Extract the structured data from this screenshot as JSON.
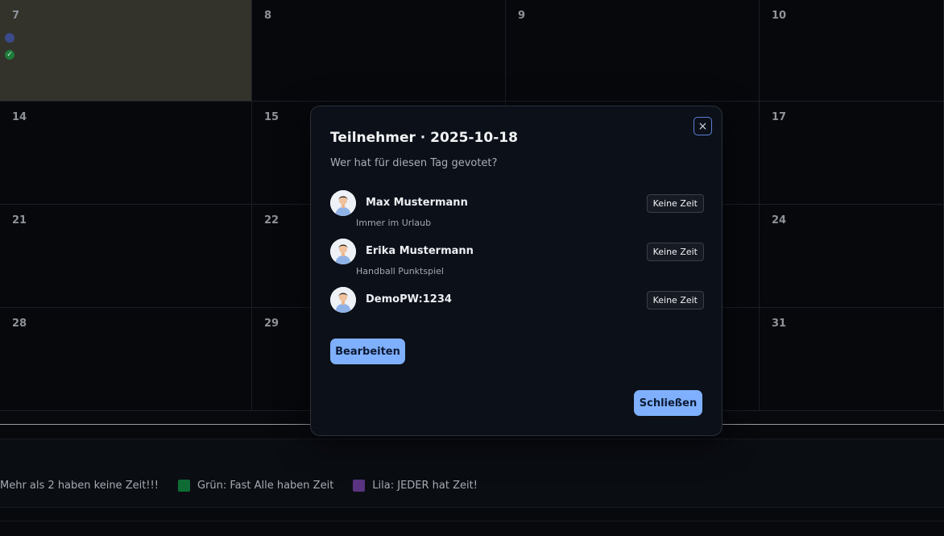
{
  "calendar": {
    "days": [
      "7",
      "8",
      "9",
      "10",
      "14",
      "15",
      "17",
      "21",
      "22",
      "24",
      "28",
      "29",
      "31"
    ]
  },
  "legend": {
    "items": [
      {
        "label": "Mehr als 2 haben keine Zeit!!!",
        "color": null
      },
      {
        "label": "Grün: Fast Alle haben Zeit",
        "color": "#0f6b34"
      },
      {
        "label": "Lila: JEDER hat Zeit!",
        "color": "#5a3380"
      }
    ]
  },
  "modal": {
    "title": "Teilnehmer · 2025-10-18",
    "subtitle": "Wer hat für diesen Tag gevotet?",
    "close_icon": "×",
    "participants": [
      {
        "name": "Max Mustermann",
        "note": "Immer im Urlaub",
        "status": "Keine Zeit"
      },
      {
        "name": "Erika Mustermann",
        "note": "Handball Punktspiel",
        "status": "Keine Zeit"
      },
      {
        "name": "DemoPW:1234",
        "note": "",
        "status": "Keine Zeit"
      }
    ],
    "edit_label": "Bearbeiten",
    "close_label": "Schließen"
  },
  "colors": {
    "accent": "#7fb0ff",
    "highlight_day": "#33332b",
    "green": "#0f6b34",
    "purple": "#5a3380"
  }
}
